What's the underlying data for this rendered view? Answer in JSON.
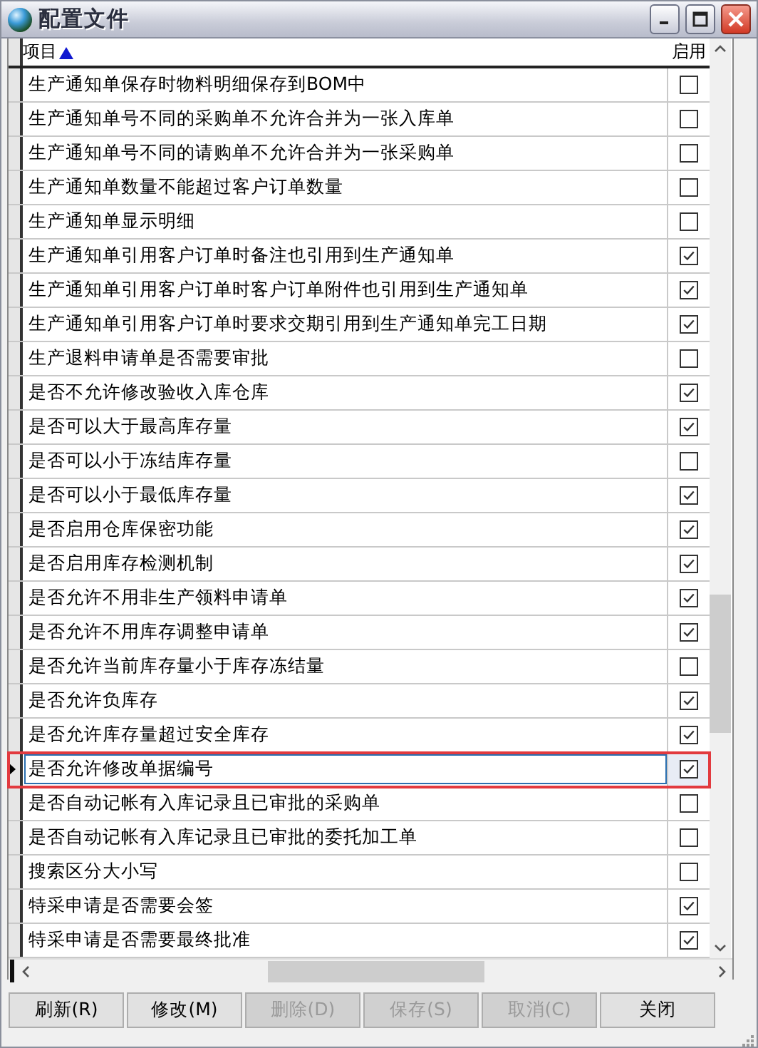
{
  "window": {
    "title": "配置文件"
  },
  "table": {
    "columns": [
      {
        "label": "项目",
        "sorted": true
      },
      {
        "label": "启用"
      }
    ],
    "rows": [
      {
        "item": "生产通知单保存时物料明细保存到BOM中",
        "checked": false,
        "selected": false
      },
      {
        "item": "生产通知单号不同的采购单不允许合并为一张入库单",
        "checked": false,
        "selected": false
      },
      {
        "item": "生产通知单号不同的请购单不允许合并为一张采购单",
        "checked": false,
        "selected": false
      },
      {
        "item": "生产通知单数量不能超过客户订单数量",
        "checked": false,
        "selected": false
      },
      {
        "item": "生产通知单显示明细",
        "checked": false,
        "selected": false
      },
      {
        "item": "生产通知单引用客户订单时备注也引用到生产通知单",
        "checked": true,
        "selected": false
      },
      {
        "item": "生产通知单引用客户订单时客户订单附件也引用到生产通知单",
        "checked": true,
        "selected": false
      },
      {
        "item": "生产通知单引用客户订单时要求交期引用到生产通知单完工日期",
        "checked": true,
        "selected": false
      },
      {
        "item": "生产退料申请单是否需要审批",
        "checked": false,
        "selected": false
      },
      {
        "item": "是否不允许修改验收入库仓库",
        "checked": true,
        "selected": false
      },
      {
        "item": "是否可以大于最高库存量",
        "checked": true,
        "selected": false
      },
      {
        "item": "是否可以小于冻结库存量",
        "checked": false,
        "selected": false
      },
      {
        "item": "是否可以小于最低库存量",
        "checked": true,
        "selected": false
      },
      {
        "item": "是否启用仓库保密功能",
        "checked": true,
        "selected": false
      },
      {
        "item": "是否启用库存检测机制",
        "checked": true,
        "selected": false
      },
      {
        "item": "是否允许不用非生产领料申请单",
        "checked": true,
        "selected": false
      },
      {
        "item": "是否允许不用库存调整申请单",
        "checked": true,
        "selected": false
      },
      {
        "item": "是否允许当前库存量小于库存冻结量",
        "checked": false,
        "selected": false
      },
      {
        "item": "是否允许负库存",
        "checked": true,
        "selected": false
      },
      {
        "item": "是否允许库存量超过安全库存",
        "checked": true,
        "selected": false
      },
      {
        "item": "是否允许修改单据编号",
        "checked": true,
        "selected": true
      },
      {
        "item": "是否自动记帐有入库记录且已审批的采购单",
        "checked": false,
        "selected": false
      },
      {
        "item": "是否自动记帐有入库记录且已审批的委托加工单",
        "checked": false,
        "selected": false
      },
      {
        "item": "搜索区分大小写",
        "checked": false,
        "selected": false
      },
      {
        "item": "特采申请是否需要会签",
        "checked": true,
        "selected": false
      },
      {
        "item": "特采申请是否需要最终批准",
        "checked": true,
        "selected": false
      }
    ]
  },
  "buttons": [
    {
      "label": "刷新(R)",
      "disabled": false
    },
    {
      "label": "修改(M)",
      "disabled": false
    },
    {
      "label": "删除(D)",
      "disabled": true
    },
    {
      "label": "保存(S)",
      "disabled": true
    },
    {
      "label": "取消(C)",
      "disabled": true
    },
    {
      "label": "关闭",
      "disabled": false
    }
  ]
}
